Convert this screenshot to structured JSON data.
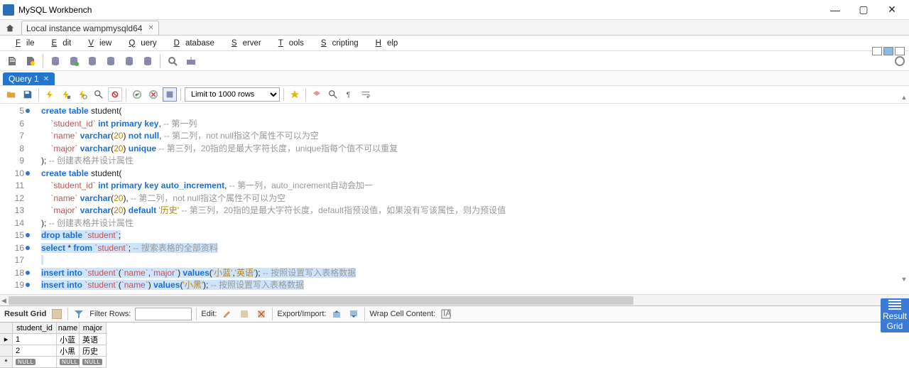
{
  "window": {
    "title": "MySQL Workbench"
  },
  "conn_tab": {
    "label": "Local instance wampmysqld64"
  },
  "menu": [
    "File",
    "Edit",
    "View",
    "Query",
    "Database",
    "Server",
    "Tools",
    "Scripting",
    "Help"
  ],
  "query_tab": {
    "label": "Query 1"
  },
  "limit": {
    "value": "Limit to 1000 rows"
  },
  "code": {
    "lines": [
      {
        "n": 5,
        "dot": true,
        "sel": false,
        "segs": [
          {
            "t": "create table",
            "c": "kw"
          },
          {
            "t": " student(",
            "c": "name"
          }
        ]
      },
      {
        "n": 6,
        "dot": false,
        "sel": false,
        "segs": [
          {
            "t": "    ",
            "c": "name"
          },
          {
            "t": "`student_id`",
            "c": "bq"
          },
          {
            "t": " ",
            "c": ""
          },
          {
            "t": "int primary key",
            "c": "kw"
          },
          {
            "t": ", ",
            "c": "name"
          },
          {
            "t": "-- 第一列",
            "c": "cm"
          }
        ]
      },
      {
        "n": 7,
        "dot": false,
        "sel": false,
        "segs": [
          {
            "t": "    ",
            "c": "name"
          },
          {
            "t": "`name`",
            "c": "bq"
          },
          {
            "t": " ",
            "c": ""
          },
          {
            "t": "varchar",
            "c": "kw"
          },
          {
            "t": "(",
            "c": "name"
          },
          {
            "t": "20",
            "c": "num"
          },
          {
            "t": ") ",
            "c": "name"
          },
          {
            "t": "not null",
            "c": "kw"
          },
          {
            "t": ", ",
            "c": "name"
          },
          {
            "t": "-- 第二列，not null指这个属性不可以为空",
            "c": "cm"
          }
        ]
      },
      {
        "n": 8,
        "dot": false,
        "sel": false,
        "segs": [
          {
            "t": "    ",
            "c": "name"
          },
          {
            "t": "`major`",
            "c": "bq"
          },
          {
            "t": " ",
            "c": ""
          },
          {
            "t": "varchar",
            "c": "kw"
          },
          {
            "t": "(",
            "c": "name"
          },
          {
            "t": "20",
            "c": "num"
          },
          {
            "t": ") ",
            "c": "name"
          },
          {
            "t": "unique",
            "c": "kw"
          },
          {
            "t": " ",
            "c": ""
          },
          {
            "t": "-- 第三列，20指的是最大字符长度，unique指每个值不可以重复",
            "c": "cm"
          }
        ]
      },
      {
        "n": 9,
        "dot": false,
        "sel": false,
        "segs": [
          {
            "t": "); ",
            "c": "name"
          },
          {
            "t": "-- 创建表格并设计属性",
            "c": "cm"
          }
        ]
      },
      {
        "n": 10,
        "dot": true,
        "sel": false,
        "segs": [
          {
            "t": "create table",
            "c": "kw"
          },
          {
            "t": " student(",
            "c": "name"
          }
        ]
      },
      {
        "n": 11,
        "dot": false,
        "sel": false,
        "segs": [
          {
            "t": "    ",
            "c": "name"
          },
          {
            "t": "`student_id`",
            "c": "bq"
          },
          {
            "t": " ",
            "c": ""
          },
          {
            "t": "int primary key auto_increment",
            "c": "kw"
          },
          {
            "t": ", ",
            "c": "name"
          },
          {
            "t": "-- 第一列，auto_increment自动会加一",
            "c": "cm"
          }
        ]
      },
      {
        "n": 12,
        "dot": false,
        "sel": false,
        "segs": [
          {
            "t": "    ",
            "c": "name"
          },
          {
            "t": "`name`",
            "c": "bq"
          },
          {
            "t": " ",
            "c": ""
          },
          {
            "t": "varchar",
            "c": "kw"
          },
          {
            "t": "(",
            "c": "name"
          },
          {
            "t": "20",
            "c": "num"
          },
          {
            "t": "), ",
            "c": "name"
          },
          {
            "t": "-- 第二列，not null指这个属性不可以为空",
            "c": "cm"
          }
        ]
      },
      {
        "n": 13,
        "dot": false,
        "sel": false,
        "segs": [
          {
            "t": "    ",
            "c": "name"
          },
          {
            "t": "`major`",
            "c": "bq"
          },
          {
            "t": " ",
            "c": ""
          },
          {
            "t": "varchar",
            "c": "kw"
          },
          {
            "t": "(",
            "c": "name"
          },
          {
            "t": "20",
            "c": "num"
          },
          {
            "t": ") ",
            "c": "name"
          },
          {
            "t": "default",
            "c": "kw"
          },
          {
            "t": " ",
            "c": ""
          },
          {
            "t": "'历史'",
            "c": "str"
          },
          {
            "t": " ",
            "c": ""
          },
          {
            "t": "-- 第三列，20指的是最大字符长度，default指预设值，如果没有写该属性，则为预设值",
            "c": "cm"
          }
        ]
      },
      {
        "n": 14,
        "dot": false,
        "sel": false,
        "segs": [
          {
            "t": "); ",
            "c": "name"
          },
          {
            "t": "-- 创建表格并设计属性",
            "c": "cm"
          }
        ]
      },
      {
        "n": 15,
        "dot": true,
        "sel": true,
        "segs": [
          {
            "t": "drop table",
            "c": "kw"
          },
          {
            "t": " ",
            "c": ""
          },
          {
            "t": "`student`",
            "c": "bq"
          },
          {
            "t": ";",
            "c": "name"
          }
        ]
      },
      {
        "n": 16,
        "dot": true,
        "sel": true,
        "segs": [
          {
            "t": "select",
            "c": "kw"
          },
          {
            "t": " * ",
            "c": "name"
          },
          {
            "t": "from",
            "c": "kw"
          },
          {
            "t": " ",
            "c": ""
          },
          {
            "t": "`student`",
            "c": "bq"
          },
          {
            "t": "; ",
            "c": "name"
          },
          {
            "t": "-- 搜索表格的全部资料",
            "c": "cm"
          }
        ]
      },
      {
        "n": 17,
        "dot": false,
        "sel": true,
        "segs": [
          {
            "t": " ",
            "c": "name"
          }
        ]
      },
      {
        "n": 18,
        "dot": true,
        "sel": true,
        "segs": [
          {
            "t": "insert into",
            "c": "kw"
          },
          {
            "t": " ",
            "c": ""
          },
          {
            "t": "`student`",
            "c": "bq"
          },
          {
            "t": "(",
            "c": "name"
          },
          {
            "t": "`name`",
            "c": "bq"
          },
          {
            "t": ",",
            "c": "name"
          },
          {
            "t": "`major`",
            "c": "bq"
          },
          {
            "t": ") ",
            "c": "name"
          },
          {
            "t": "values",
            "c": "kw"
          },
          {
            "t": "(",
            "c": "name"
          },
          {
            "t": "'小蓝'",
            "c": "str"
          },
          {
            "t": ",",
            "c": "name"
          },
          {
            "t": "'英语'",
            "c": "str"
          },
          {
            "t": "); ",
            "c": "name"
          },
          {
            "t": "-- 按照设置写入表格数据",
            "c": "cm"
          }
        ]
      },
      {
        "n": 19,
        "dot": true,
        "sel": true,
        "segs": [
          {
            "t": "insert into",
            "c": "kw"
          },
          {
            "t": " ",
            "c": ""
          },
          {
            "t": "`student`",
            "c": "bq"
          },
          {
            "t": "(",
            "c": "name"
          },
          {
            "t": "`name`",
            "c": "bq"
          },
          {
            "t": ") ",
            "c": "name"
          },
          {
            "t": "values",
            "c": "kw"
          },
          {
            "t": "(",
            "c": "name"
          },
          {
            "t": "'小黑'",
            "c": "str"
          },
          {
            "t": "); ",
            "c": "name"
          },
          {
            "t": "-- 按照设置写入表格数据",
            "c": "cm"
          }
        ]
      }
    ]
  },
  "resultbar": {
    "title": "Result Grid",
    "filter_label": "Filter Rows:",
    "edit_label": "Edit:",
    "export_label": "Export/Import:",
    "wrap_label": "Wrap Cell Content:"
  },
  "grid": {
    "cols": [
      "student_id",
      "name",
      "major"
    ],
    "rows": [
      {
        "marker": "▸",
        "cells": [
          "1",
          "小蓝",
          "英语"
        ]
      },
      {
        "marker": "",
        "cells": [
          "2",
          "小黑",
          "历史"
        ]
      },
      {
        "marker": "*",
        "cells": [
          "NULL",
          "NULL",
          "NULL"
        ],
        "null": true
      }
    ]
  },
  "sidepanel": {
    "l1": "Result",
    "l2": "Grid"
  }
}
